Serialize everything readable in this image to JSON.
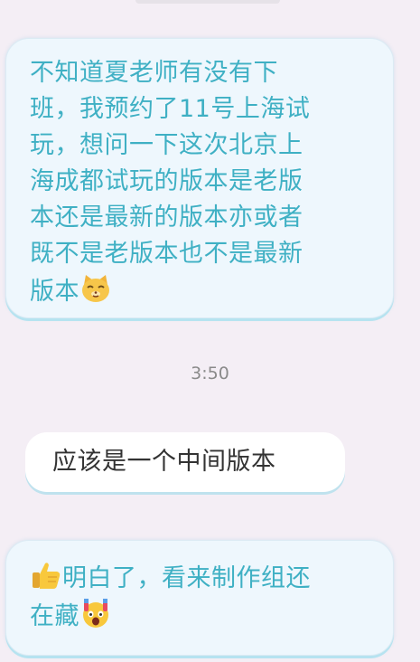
{
  "messages": [
    {
      "direction": "incoming",
      "lines": [
        "不知道夏老师有没有下",
        "班，我预约了11号上海试",
        "玩，想问一下这次北京上",
        "海成都试玩的版本是老版",
        "本还是最新的版本亦或者",
        "既不是老版本也不是最新",
        "版本"
      ],
      "trailing_emoji": "cat-face-emoji"
    },
    {
      "direction": "outgoing",
      "text": "应该是一个中间版本"
    },
    {
      "direction": "incoming",
      "leading_emoji": "thumbs-up-emoji",
      "lines": [
        "明白了，看来制作组还",
        "在藏"
      ],
      "trailing_emoji": "shocked-face-emoji"
    }
  ],
  "timestamp": "3:50",
  "colors": {
    "background": "#f4eef5",
    "incoming_bubble": "#eef7fd",
    "incoming_text": "#3fb0c4",
    "outgoing_bubble": "#ffffff",
    "outgoing_text": "#333333",
    "timestamp_text": "#8a8a8a"
  }
}
